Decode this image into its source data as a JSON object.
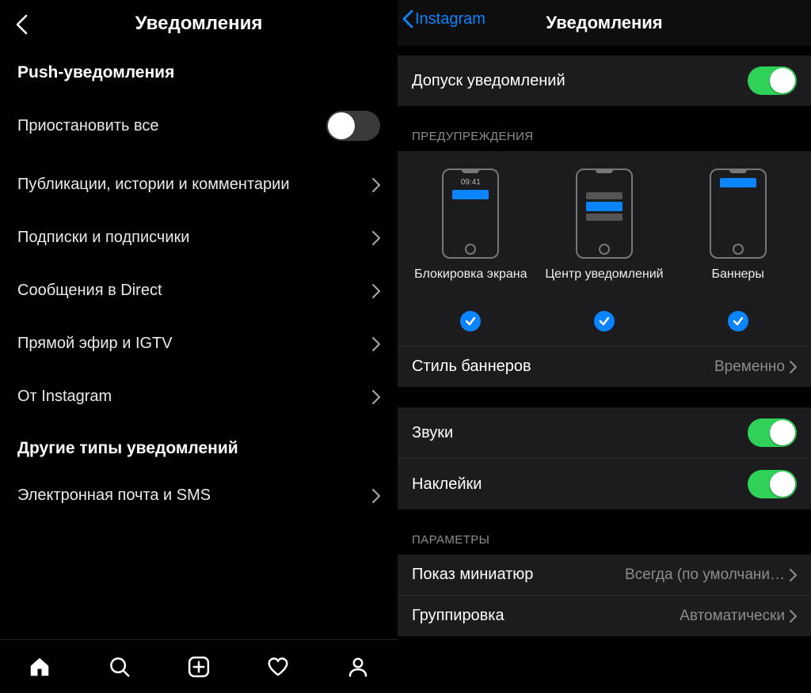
{
  "left": {
    "header_title": "Уведомления",
    "section1": "Push-уведомления",
    "pause_all": "Приостановить все",
    "items": [
      "Публикации, истории и комментарии",
      "Подписки и подписчики",
      "Сообщения в Direct",
      "Прямой эфир и IGTV",
      "От Instagram"
    ],
    "section2": "Другие типы уведомлений",
    "item_email_sms": "Электронная почта и SMS"
  },
  "right": {
    "back_label": "Instagram",
    "title": "Уведомления",
    "allow_label": "Допуск уведомлений",
    "alerts_header": "ПРЕДУПРЕЖДЕНИЯ",
    "alert_time": "09:41",
    "alert_labels": {
      "lock": "Блокировка экрана",
      "center": "Центр уведомлений",
      "banner": "Баннеры"
    },
    "banner_style_label": "Стиль баннеров",
    "banner_style_value": "Временно",
    "sounds_label": "Звуки",
    "badges_label": "Наклейки",
    "params_header": "ПАРАМЕТРЫ",
    "previews_label": "Показ миниатюр",
    "previews_value": "Всегда (по умолчани…",
    "grouping_label": "Группировка",
    "grouping_value": "Автоматически"
  }
}
